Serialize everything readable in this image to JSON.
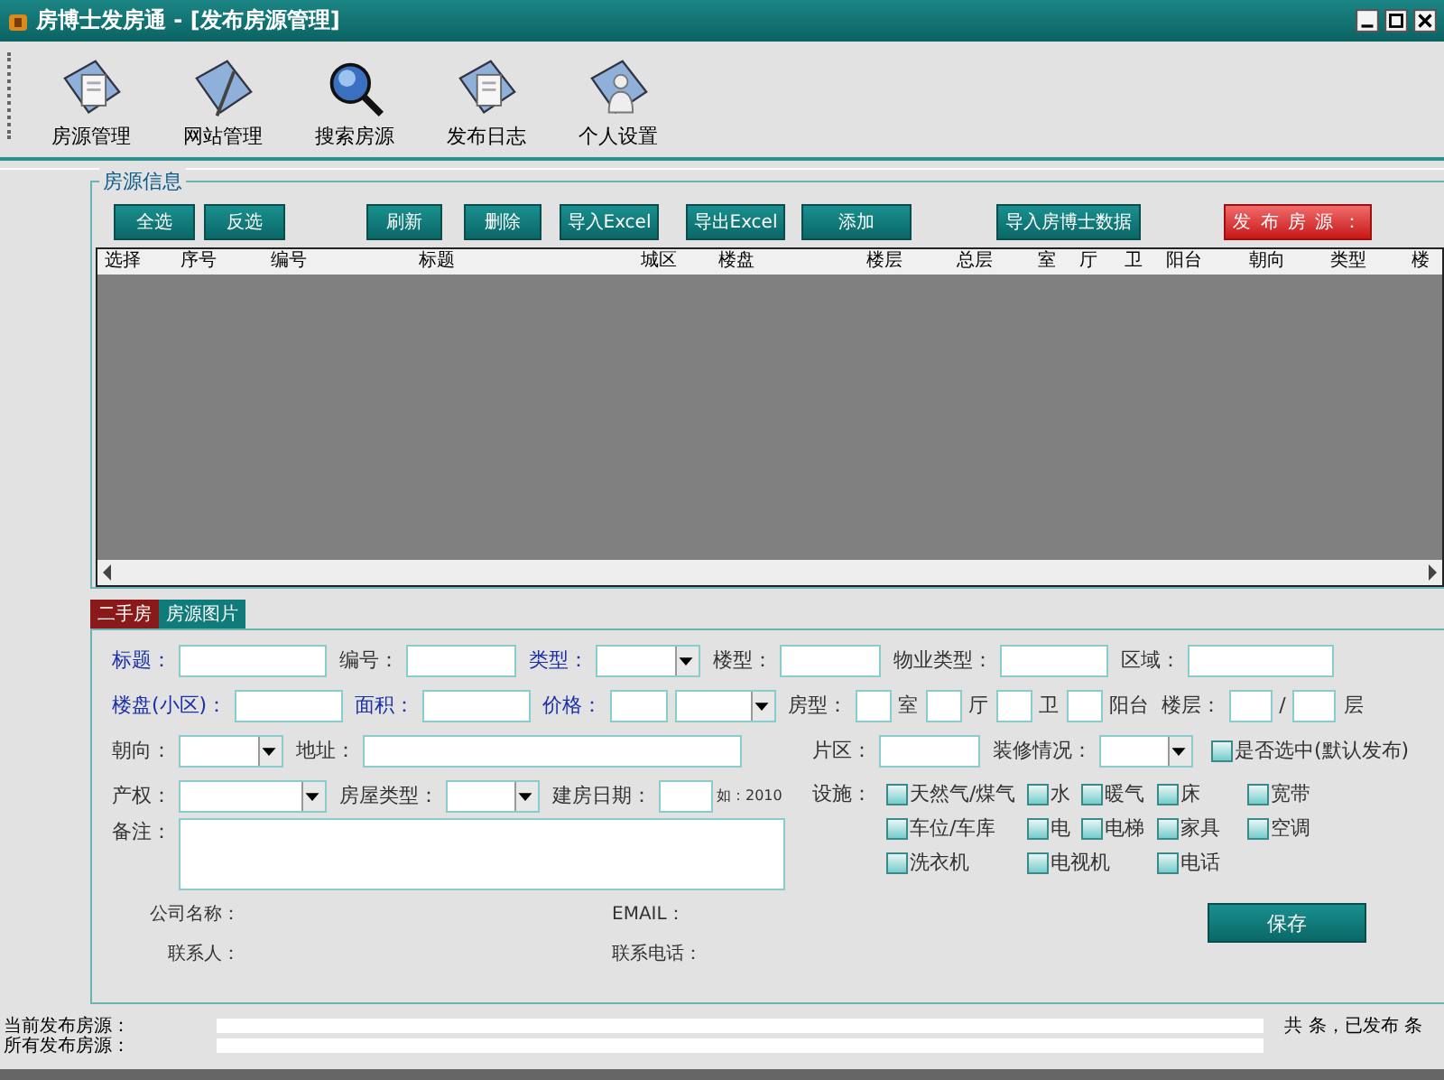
{
  "window": {
    "title": "房博士发房通 - [发布房源管理]"
  },
  "toolbar": [
    {
      "label": "房源管理",
      "kind": "document"
    },
    {
      "label": "网站管理",
      "kind": "pen"
    },
    {
      "label": "搜索房源",
      "kind": "search"
    },
    {
      "label": "发布日志",
      "kind": "document"
    },
    {
      "label": "个人设置",
      "kind": "person"
    }
  ],
  "group": {
    "title": "房源信息",
    "buttons": [
      {
        "label": "全选",
        "kind": "normal"
      },
      {
        "label": "反选",
        "kind": "normal"
      },
      {
        "label": "刷新",
        "kind": "normal"
      },
      {
        "label": "删除",
        "kind": "normal"
      },
      {
        "label": "导入Excel",
        "kind": "normal"
      },
      {
        "label": "导出Excel",
        "kind": "normal"
      },
      {
        "label": "添加",
        "kind": "normal"
      },
      {
        "label": "导入房博士数据",
        "kind": "normal"
      },
      {
        "label": "发 布 房 源 ：",
        "kind": "publish"
      }
    ],
    "table": {
      "columns": [
        "选择",
        "序号",
        "编号",
        "标题",
        "城区",
        "楼盘",
        "楼层",
        "总层",
        "室",
        "厅",
        "卫",
        "阳台",
        "朝向",
        "类型",
        "楼"
      ]
    }
  },
  "tabs": [
    {
      "label": "二手房",
      "selected": true
    },
    {
      "label": "房源图片",
      "selected": false
    }
  ],
  "form": {
    "rows": [
      [
        {
          "kind": "label",
          "text": "标题：",
          "required": true
        },
        {
          "kind": "text"
        },
        {
          "kind": "label",
          "text": "编号：",
          "required": false
        },
        {
          "kind": "text"
        },
        {
          "kind": "label",
          "text": "类型：",
          "required": true
        },
        {
          "kind": "select"
        },
        {
          "kind": "label",
          "text": "楼型：",
          "required": false
        },
        {
          "kind": "text"
        },
        {
          "kind": "label",
          "text": "物业类型：",
          "required": false
        },
        {
          "kind": "text"
        },
        {
          "kind": "label",
          "text": "区域：",
          "required": false
        },
        {
          "kind": "text"
        }
      ],
      [
        {
          "kind": "label",
          "text": "楼盘(小区)：",
          "required": true
        },
        {
          "kind": "text"
        },
        {
          "kind": "label",
          "text": "面积：",
          "required": true
        },
        {
          "kind": "text"
        },
        {
          "kind": "label",
          "text": "价格：",
          "required": true
        },
        {
          "kind": "text"
        },
        {
          "kind": "select"
        },
        {
          "kind": "label",
          "text": "房型：",
          "required": false
        },
        {
          "kind": "text"
        },
        {
          "kind": "unit",
          "text": "室"
        },
        {
          "kind": "text"
        },
        {
          "kind": "unit",
          "text": "厅"
        },
        {
          "kind": "text"
        },
        {
          "kind": "unit",
          "text": "卫"
        },
        {
          "kind": "text"
        },
        {
          "kind": "unit",
          "text": "阳台"
        },
        {
          "kind": "label",
          "text": "楼层：",
          "required": false
        },
        {
          "kind": "text"
        },
        {
          "kind": "unit",
          "text": "/"
        },
        {
          "kind": "text"
        },
        {
          "kind": "unit",
          "text": "层"
        }
      ]
    ],
    "left_rows": [
      [
        {
          "kind": "label",
          "text": "朝向：",
          "required": false
        },
        {
          "kind": "select"
        },
        {
          "kind": "label",
          "text": "地址：",
          "required": false
        },
        {
          "kind": "text"
        }
      ],
      [
        {
          "kind": "label",
          "text": "产权：",
          "required": false
        },
        {
          "kind": "select"
        },
        {
          "kind": "label",
          "text": "房屋类型：",
          "required": false
        },
        {
          "kind": "select"
        },
        {
          "kind": "label",
          "text": "建房日期：",
          "required": false
        },
        {
          "kind": "text"
        },
        {
          "kind": "hint",
          "text": "如：2010"
        }
      ]
    ],
    "right_row": [
      {
        "kind": "label",
        "text": "片区：",
        "required": false
      },
      {
        "kind": "text"
      },
      {
        "kind": "label",
        "text": "装修情况：",
        "required": false
      },
      {
        "kind": "select"
      },
      {
        "kind": "checkbox",
        "text": "是否选中(默认发布)",
        "checked": false
      }
    ],
    "facilities": {
      "label": "设施：",
      "rows": [
        [
          {
            "text": "天然气/煤气",
            "checked": false
          },
          {
            "text": "水",
            "checked": false
          },
          {
            "text": "暖气",
            "checked": false
          },
          {
            "text": "床",
            "checked": false
          },
          {
            "text": "宽带",
            "checked": false
          }
        ],
        [
          {
            "text": "车位/车库",
            "checked": false
          },
          {
            "text": "电",
            "checked": false
          },
          {
            "text": "电梯",
            "checked": false
          },
          {
            "text": "家具",
            "checked": false
          },
          {
            "text": "空调",
            "checked": false
          }
        ],
        [
          {
            "text": "洗衣机",
            "checked": false
          },
          {
            "text": "电视机",
            "checked": false
          },
          "",
          {
            "text": "电话",
            "checked": false
          }
        ]
      ]
    },
    "remark": {
      "label": "备注："
    },
    "contact": [
      {
        "label": "公司名称："
      },
      {
        "label": "EMAIL："
      },
      {
        "label": "联系人："
      },
      {
        "label": "联系电话："
      }
    ],
    "save_button": "保存"
  },
  "status": {
    "rows": [
      {
        "label": "当前发布房源：",
        "level": 0
      },
      {
        "label": "所有发布房源：",
        "level": 0
      }
    ],
    "summary": "共 条，已发布 条"
  }
}
